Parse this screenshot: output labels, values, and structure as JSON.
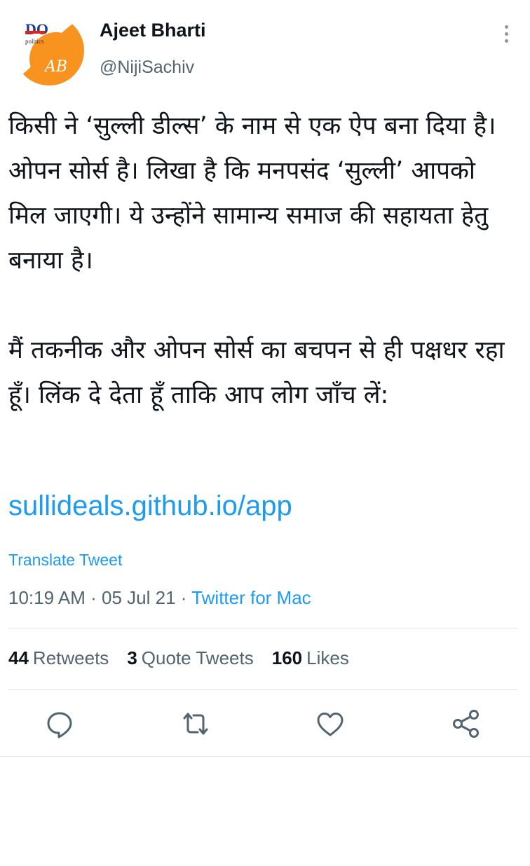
{
  "author": {
    "display_name": "Ajeet Bharti",
    "handle": "@NijiSachiv",
    "avatar": {
      "badge_text": "DO",
      "badge_subtext": "politics",
      "monogram": "AB",
      "accent_color": "#f7931e"
    }
  },
  "tweet": {
    "text": "किसी ने ‘सुल्ली डील्स’ के नाम से एक ऐप बना दिया है। ओपन सोर्स है। लिखा है कि मनपसंद ‘सुल्ली’ आपको मिल जाएगी। ये उन्होंने सामान्य समाज की सहायता हेतु बनाया है।\n\nमैं तकनीक और ओपन सोर्स का बचपन से ही पक्षधर रहा हूँ। लिंक दे देता हूँ ताकि आप लोग जाँच लें:",
    "link": "sullideals.github.io/app",
    "translate_label": "Translate Tweet",
    "time": "10:19 AM",
    "date": "05 Jul 21",
    "separator": "·",
    "source": "Twitter for Mac"
  },
  "stats": {
    "retweets": {
      "count": "44",
      "label": "Retweets"
    },
    "quotes": {
      "count": "3",
      "label": "Quote Tweets"
    },
    "likes": {
      "count": "160",
      "label": "Likes"
    }
  },
  "actions": [
    "reply-icon",
    "retweet-icon",
    "like-icon",
    "share-icon"
  ],
  "colors": {
    "link": "#1d9bf0",
    "secondary_text": "#536471",
    "primary_text": "#0f1419",
    "divider": "#dfe3e6",
    "icon": "#536471"
  }
}
